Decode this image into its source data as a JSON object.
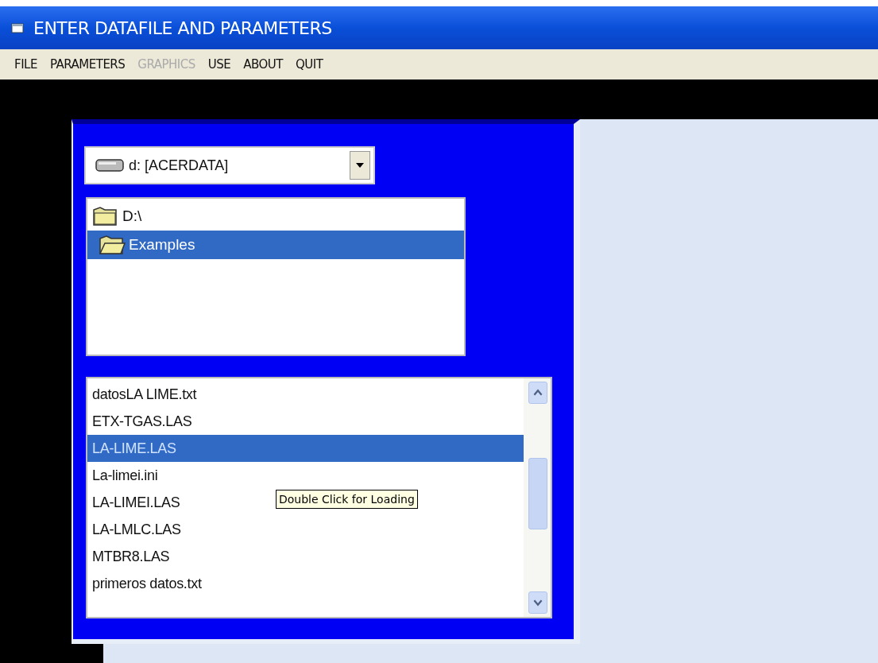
{
  "window": {
    "title": "ENTER DATAFILE AND PARAMETERS"
  },
  "menu": [
    {
      "label": "FILE",
      "disabled": false
    },
    {
      "label": "PARAMETERS",
      "disabled": false
    },
    {
      "label": "GRAPHICS",
      "disabled": true
    },
    {
      "label": "USE",
      "disabled": false
    },
    {
      "label": "ABOUT",
      "disabled": false
    },
    {
      "label": "QUIT",
      "disabled": false
    }
  ],
  "drive": {
    "value": "d: [ACERDATA]"
  },
  "directories": [
    {
      "label": "D:\\",
      "selected": false
    },
    {
      "label": "Examples",
      "selected": true
    }
  ],
  "files": [
    {
      "label": "datosLA LIME.txt",
      "selected": false
    },
    {
      "label": "ETX-TGAS.LAS",
      "selected": false
    },
    {
      "label": "LA-LIME.LAS",
      "selected": true
    },
    {
      "label": "La-limei.ini",
      "selected": false
    },
    {
      "label": "LA-LIMEI.LAS",
      "selected": false
    },
    {
      "label": "LA-LMLC.LAS",
      "selected": false
    },
    {
      "label": "MTBR8.LAS",
      "selected": false
    },
    {
      "label": "primeros datos.txt",
      "selected": false
    }
  ],
  "tooltip": "Double Click for Loading"
}
